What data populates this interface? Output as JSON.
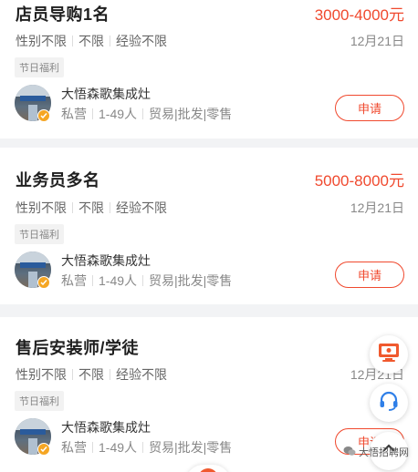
{
  "jobs": [
    {
      "title": "店员导购1名",
      "salary": "3000-4000元",
      "requirements": [
        "性别不限",
        "不限",
        "经验不限"
      ],
      "date": "12月21日",
      "tag": "节日福利",
      "company": "大悟森歌集成灶",
      "company_type": "私营",
      "company_size": "1-49人",
      "industry": "贸易|批发|零售",
      "apply_label": "申请"
    },
    {
      "title": "业务员多名",
      "salary": "5000-8000元",
      "requirements": [
        "性别不限",
        "不限",
        "经验不限"
      ],
      "date": "12月21日",
      "tag": "节日福利",
      "company": "大悟森歌集成灶",
      "company_type": "私营",
      "company_size": "1-49人",
      "industry": "贸易|批发|零售",
      "apply_label": "申请"
    },
    {
      "title": "售后安装师/学徒",
      "salary": "",
      "requirements": [
        "性别不限",
        "不限",
        "经验不限"
      ],
      "date": "12月21日",
      "tag": "节日福利",
      "company": "大悟森歌集成灶",
      "company_type": "私营",
      "company_size": "1-49人",
      "industry": "贸易|批发|零售",
      "apply_label": "申请"
    }
  ],
  "floating": {
    "watermark": "大悟招聘网"
  },
  "icons": [
    "monitor-icon",
    "headset-icon",
    "scroll-up-icon",
    "verified-badge-icon"
  ],
  "colors": {
    "accent": "#f0492e",
    "badge": "#f5a623",
    "headset": "#2f7fe8"
  }
}
